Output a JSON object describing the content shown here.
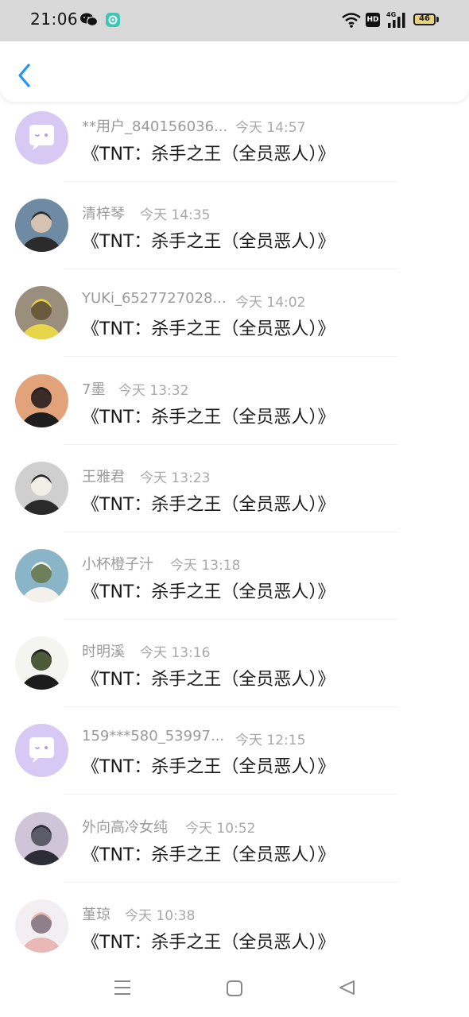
{
  "status_bar": {
    "time": "21:06",
    "network": "4G",
    "hd": "HD",
    "battery": "46"
  },
  "header": {
    "back_icon": "chevron-left-icon"
  },
  "comments": [
    {
      "user": "**用户_840156036...",
      "time": "今天 14:57",
      "text": "《TNT：杀手之王（全员恶人）》",
      "avatar": "default-chat"
    },
    {
      "user": "清梓琴",
      "time": "今天 14:35",
      "text": "《TNT：杀手之王（全员恶人）》",
      "avatar": "photo"
    },
    {
      "user": "YUKi_6527727028...",
      "time": "今天 14:02",
      "text": "《TNT：杀手之王（全员恶人）》",
      "avatar": "photo"
    },
    {
      "user": "7墨",
      "time": "今天 13:32",
      "text": "《TNT：杀手之王（全员恶人）》",
      "avatar": "photo"
    },
    {
      "user": "王雅君",
      "time": "今天 13:23",
      "text": "《TNT：杀手之王（全员恶人）》",
      "avatar": "photo"
    },
    {
      "user": "小杯橙子汁",
      "time": "今天 13:18",
      "text": "《TNT：杀手之王（全员恶人）》",
      "avatar": "photo"
    },
    {
      "user": "时明溪",
      "time": "今天 13:16",
      "text": "《TNT：杀手之王（全员恶人）》",
      "avatar": "photo"
    },
    {
      "user": "159***580_53997...",
      "time": "今天 12:15",
      "text": "《TNT：杀手之王（全员恶人）》",
      "avatar": "default-chat"
    },
    {
      "user": "外向高冷女纯",
      "time": "今天 10:52",
      "text": "《TNT：杀手之王（全员恶人）》",
      "avatar": "photo"
    },
    {
      "user": "堇琼",
      "time": "今天 10:38",
      "text": "《TNT：杀手之王（全员恶人）》",
      "avatar": "photo"
    }
  ],
  "colors": {
    "accent": "#2196f3",
    "default_avatar_bg": "#d8c8f4",
    "status_bar_bg": "#d9d9d9",
    "username": "#9a9a9a",
    "timestamp": "#a8a8a8",
    "message": "#1a1a1a"
  },
  "nav_bar": {
    "menu_icon": "menu-icon",
    "home_icon": "home-square-icon",
    "back_icon": "back-triangle-icon"
  }
}
